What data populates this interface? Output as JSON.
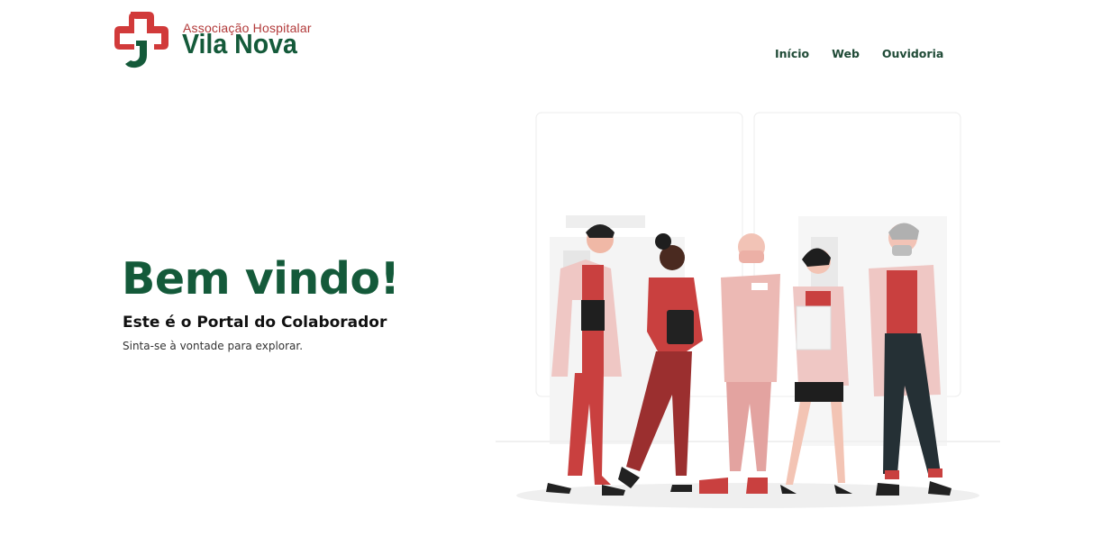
{
  "header": {
    "logo_subtitle": "Associação Hospitalar",
    "logo_name": "Vila Nova",
    "brand_red": "#d13a3a",
    "brand_green": "#145a3a"
  },
  "nav": {
    "items": [
      {
        "label": "Início"
      },
      {
        "label": "Web"
      },
      {
        "label": "Ouvidoria"
      }
    ]
  },
  "hero": {
    "title": "Bem vindo!",
    "subtitle": "Este é o Portal do Colaborador",
    "note": "Sinta-se à vontade para explorar."
  },
  "illustration": {
    "subject": "medical-team-illustration"
  }
}
